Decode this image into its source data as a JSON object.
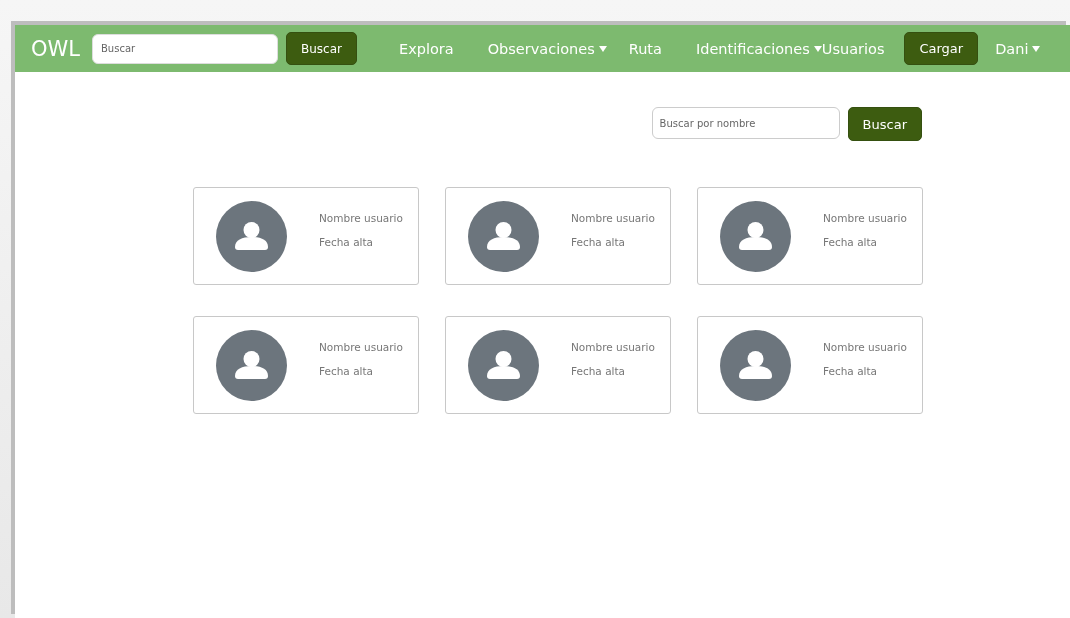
{
  "navbar": {
    "brand": "OWL",
    "search": {
      "placeholder": "Buscar"
    },
    "search_button": "Buscar",
    "items": [
      {
        "label": "Explora",
        "dropdown": false
      },
      {
        "label": "Observaciones",
        "dropdown": true
      },
      {
        "label": "Ruta",
        "dropdown": false
      },
      {
        "label": "Identificaciones",
        "dropdown": true
      },
      {
        "label": "Usuarios",
        "dropdown": false
      }
    ],
    "upload_button": "Cargar",
    "user": {
      "label": "Dani",
      "dropdown": true
    }
  },
  "user_search": {
    "placeholder": "Buscar por nombre",
    "button": "Buscar"
  },
  "users": [
    {
      "name": "Nombre usuario",
      "date": "Fecha alta"
    },
    {
      "name": "Nombre usuario",
      "date": "Fecha alta"
    },
    {
      "name": "Nombre usuario",
      "date": "Fecha alta"
    },
    {
      "name": "Nombre usuario",
      "date": "Fecha alta"
    },
    {
      "name": "Nombre usuario",
      "date": "Fecha alta"
    },
    {
      "name": "Nombre usuario",
      "date": "Fecha alta"
    }
  ]
}
